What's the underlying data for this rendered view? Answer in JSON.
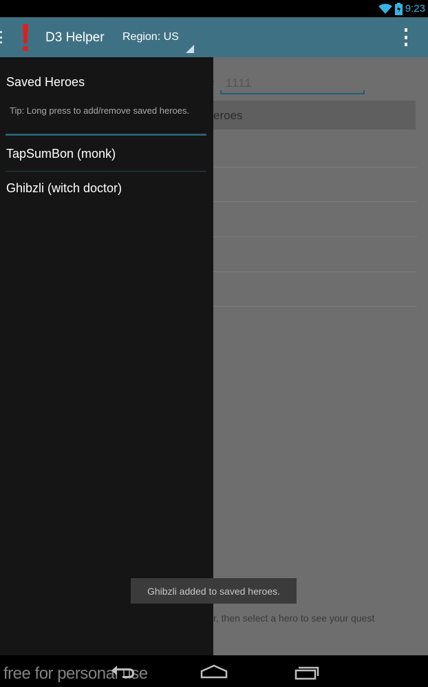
{
  "status_bar": {
    "time": "9:23",
    "icons": [
      "wifi-icon",
      "battery-charging-icon"
    ],
    "accent_color": "#33b5e5"
  },
  "action_bar": {
    "app_icon": "exclamation-icon",
    "title": "D3 Helper",
    "region_spinner": "Region: US",
    "overflow_icon": "overflow-menu-icon",
    "background_color": "#3f7184"
  },
  "background_content": {
    "battletag_hash": "#",
    "battletag_number": "1111",
    "get_heroes_button": "eroes",
    "footer_hint": "r, then select a hero to see your quest"
  },
  "drawer": {
    "title": "Saved Heroes",
    "tip": "Tip: Long press to add/remove saved heroes.",
    "items": [
      {
        "label": "TapSumBon (monk)"
      },
      {
        "label": "Ghibzli (witch doctor)"
      }
    ]
  },
  "toast": {
    "message": "Ghibzli added to saved heroes."
  },
  "nav_bar": {
    "watermark": "free for personal use",
    "buttons": [
      "back-icon",
      "home-icon",
      "recent-apps-icon"
    ]
  }
}
